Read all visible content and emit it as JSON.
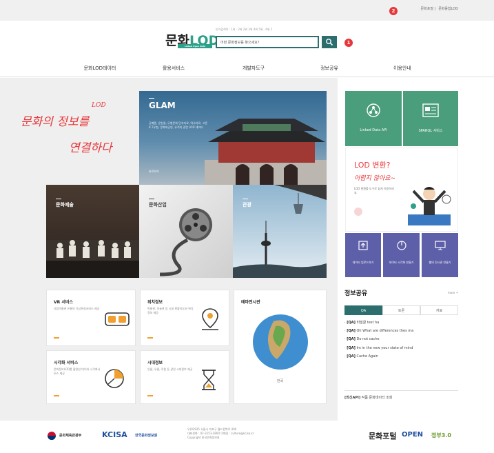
{
  "top_links": [
    "문화포털",
    "문화융합LOD"
  ],
  "badges": {
    "two": "2",
    "one": "1"
  },
  "logo": {
    "brand_a": "문화",
    "brand_b": "LOD",
    "sub": "Linked Open Data"
  },
  "popular": "인기검색어 : 1위 · 2위 2위 3위 4위 5위 · 6위 1",
  "search": {
    "placeholder": "어떤 문화정보를 찾으세요?"
  },
  "nav": [
    "문화LOD데이터",
    "활용서비스",
    "개발자도구",
    "정보공유",
    "이용안내"
  ],
  "hero_script": {
    "line1": "문화의 정보를",
    "line2": "연결하다",
    "lod": "LOD"
  },
  "glam": {
    "title": "GLAM",
    "desc": "공예품, 문헌물, 무형문화 민속자료, 역사자료, 고문 ICT유형, 문화재공연, 유적지 관련 LOD 데이터",
    "more": "바로보기"
  },
  "tiles": {
    "art": "문화예술",
    "industry": "문화산업",
    "tour": "관광"
  },
  "cards": [
    {
      "title": "VR 서비스",
      "desc": "국립박물관 유물의 가상현실서비스 제공"
    },
    {
      "title": "위치정보",
      "desc": "박물관, 미술관 등 시설 현황지도와 위치정보 제공"
    },
    {
      "title": "시각화 서비스",
      "desc": "문화정보LOD를 활용한 데이터 시각화서비스 제공"
    },
    {
      "title": "시대정보",
      "desc": "인물, 유물, 작품 등 관련 시대정보 제공"
    }
  ],
  "map_card": {
    "title": "테마전시관",
    "caption": "한국"
  },
  "side_tiles": {
    "api": "Linked Data API",
    "sparql": "SPARQL 서비스",
    "lod_title": "LOD 변환?",
    "lod_script": "어렵지 않아요~",
    "lod_desc": "LOD 변환툴 도구로 쉽게 이용하세요",
    "p1": "데이터 업로드하기",
    "p2": "데이터 시각화 만들기",
    "p3": "웹의 전시관 만들기"
  },
  "info": {
    "title": "정보공유",
    "more": "more +",
    "tabs": [
      "QA",
      "토론",
      "자료"
    ],
    "items": [
      {
        "tag": "[QA]",
        "text": "비밀글 test ha"
      },
      {
        "tag": "[QA]",
        "text": "Oh What are differences thes ma"
      },
      {
        "tag": "[QA]",
        "text": "Do not cache"
      },
      {
        "tag": "[QA]",
        "text": "Im in the new your state of mind"
      },
      {
        "tag": "[QA]",
        "text": "Cache Again"
      }
    ],
    "notice_tag": "[최신API]",
    "notice_text": "작품 문화데이터 조회"
  },
  "footer": {
    "ministry": "문화체육관광부",
    "kcisa": "KCISA",
    "kcisa_sub": "한국문화정보원",
    "address": "우)03925 서울시 마포구 월드컵북로 400",
    "contact": "대표전화 : 02-3153-2800 이메일 : culture@kcisa.kr",
    "copyright": "Copyright 한국문화정보원",
    "f1": "문화포털",
    "f2": "OPEN",
    "f3": "정부3.0"
  },
  "colors": {
    "teal": "#2b6e6d",
    "green_tile": "#4a9e7c",
    "purple": "#5d5fa8",
    "red": "#e8373a"
  }
}
